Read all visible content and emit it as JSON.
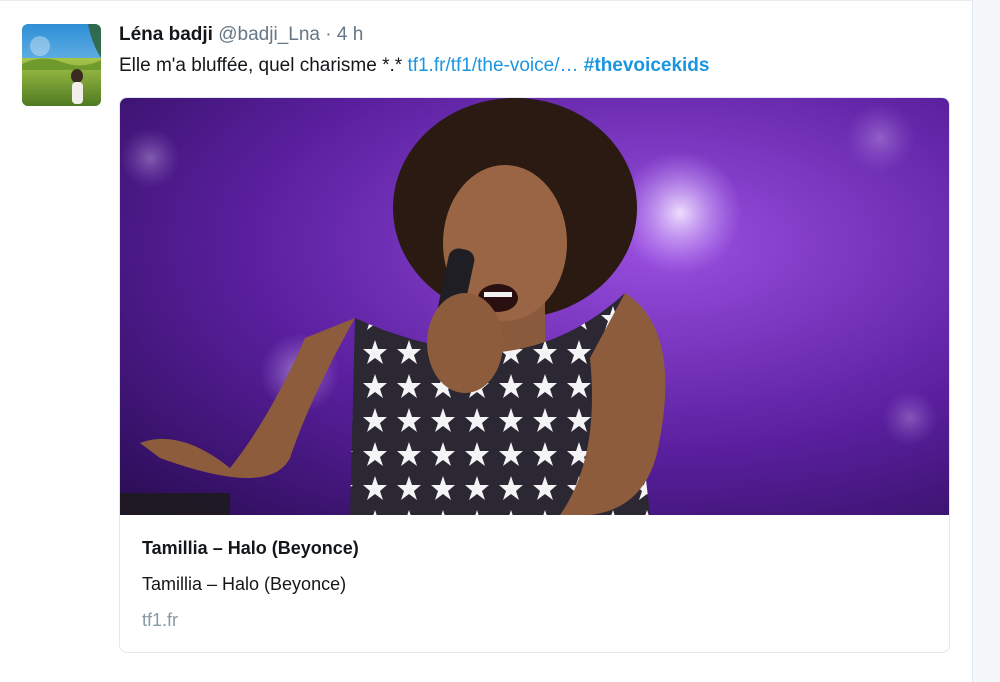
{
  "tweet": {
    "author_name": "Léna badji",
    "author_handle": "@badji_Lna",
    "separator": "·",
    "timestamp": "4 h",
    "text": "Elle m'a bluffée, quel charisme *.*",
    "link_text": "tf1.fr/tf1/the-voice/…",
    "hashtag": "#thevoicekids"
  },
  "card": {
    "title": "Tamillia – Halo (Beyonce)",
    "description": "Tamillia – Halo (Beyonce)",
    "domain": "tf1.fr",
    "image_icon": "singer-photo"
  },
  "colors": {
    "link": "#1b95e0",
    "text": "#14171a",
    "secondary": "#657786",
    "card_stage_purple": "#5a1f9e"
  }
}
